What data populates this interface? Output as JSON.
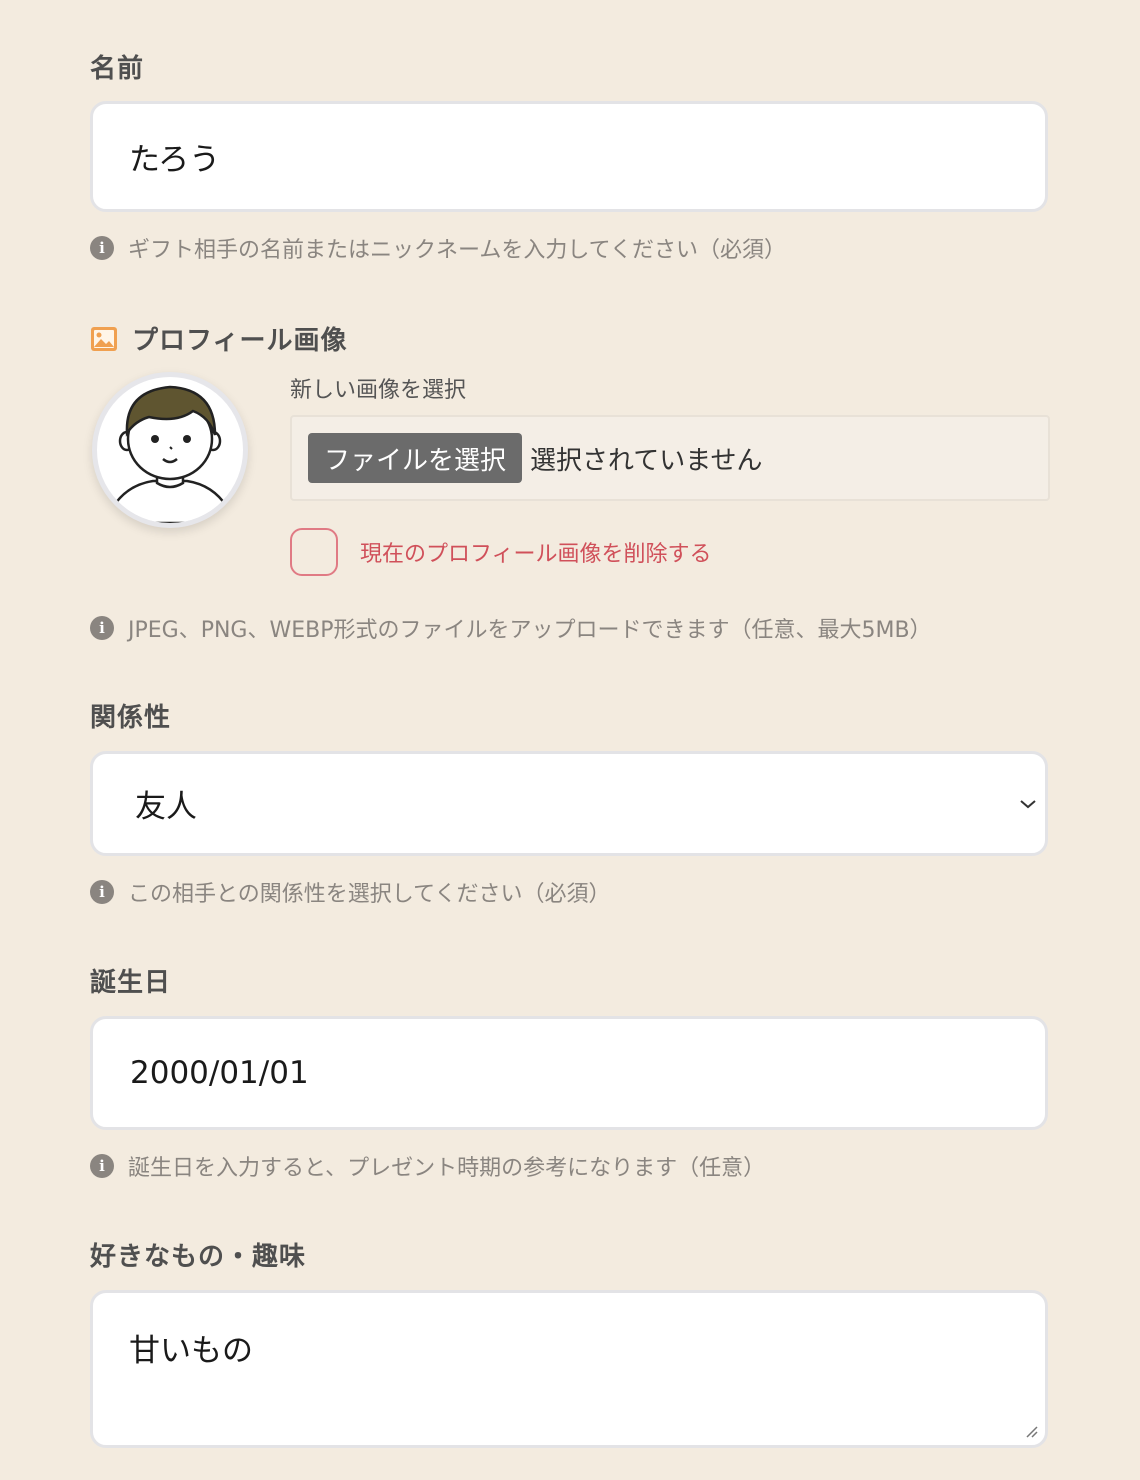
{
  "name_section": {
    "label": "名前",
    "value": "たろう",
    "help": "ギフト相手の名前またはニックネームを入力してください（必須）"
  },
  "profile_section": {
    "label": "プロフィール画像",
    "new_image_label": "新しい画像を選択",
    "file_button": "ファイルを選択",
    "file_status": "選択されていません",
    "delete_label": "現在のプロフィール画像を削除する",
    "delete_checked": false,
    "help": "JPEG、PNG、WEBP形式のファイルをアップロードできます（任意、最大5MB）"
  },
  "relation_section": {
    "label": "関係性",
    "selected": "友人",
    "help": "この相手との関係性を選択してください（必須）"
  },
  "birthday_section": {
    "label": "誕生日",
    "value": "2000/01/01",
    "help": "誕生日を入力すると、プレゼント時期の参考になります（任意）"
  },
  "likes_section": {
    "label": "好きなもの・趣味",
    "value": "甘いもの"
  },
  "icons": {
    "info": "info-icon",
    "image": "image-icon",
    "chevron": "chevron-down-icon",
    "resize": "resize-handle-icon"
  },
  "colors": {
    "background": "#f3ebdf",
    "accent_orange": "#f0a050",
    "danger": "#d0505a",
    "help_text": "#8a8580"
  }
}
